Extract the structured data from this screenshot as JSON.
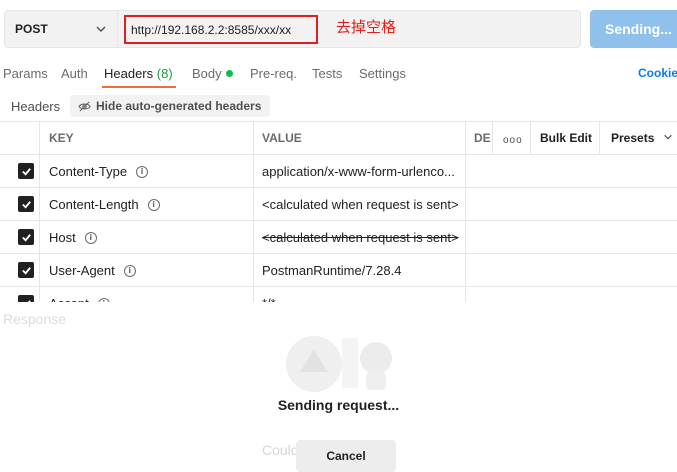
{
  "request": {
    "method": "POST",
    "url": "http://192.168.2.2:8585/xxx/xx",
    "annotation": "去掉空格",
    "send_label": "Sending..."
  },
  "tabs": [
    {
      "label": "Params"
    },
    {
      "label": "Auth"
    },
    {
      "label": "Headers",
      "count": "(8)",
      "active": true
    },
    {
      "label": "Body"
    },
    {
      "label": "Pre-req."
    },
    {
      "label": "Tests"
    },
    {
      "label": "Settings"
    }
  ],
  "cookies_label": "Cookie",
  "headers_bar": {
    "label": "Headers",
    "hide_button": "Hide auto-generated headers"
  },
  "table": {
    "columns": {
      "key": "KEY",
      "value": "VALUE",
      "desc": "DE",
      "more": "ooo",
      "bulk_edit": "Bulk Edit",
      "presets": "Presets"
    },
    "rows": [
      {
        "key": "Content-Type",
        "value": "application/x-www-form-urlenco...",
        "checked": true,
        "strike": false
      },
      {
        "key": "Content-Length",
        "value": "<calculated when request is sent>",
        "checked": true,
        "strike": false
      },
      {
        "key": "Host",
        "value": "<calculated when request is sent>",
        "checked": true,
        "strike": true
      },
      {
        "key": "User-Agent",
        "value": "PostmanRuntime/7.28.4",
        "checked": true,
        "strike": false
      },
      {
        "key": "Accept",
        "value": "*/*",
        "checked": true,
        "strike": false
      }
    ]
  },
  "response": {
    "label": "Response",
    "sending_text": "Sending request...",
    "couldnt_text": "Could                    est",
    "cancel_label": "Cancel"
  },
  "colors": {
    "accent_underline": "#f26b3a",
    "send_button": "#90c0ec",
    "annotation_red": "#e02020",
    "link_blue": "#097bed",
    "body_dot": "#0cbb52"
  }
}
